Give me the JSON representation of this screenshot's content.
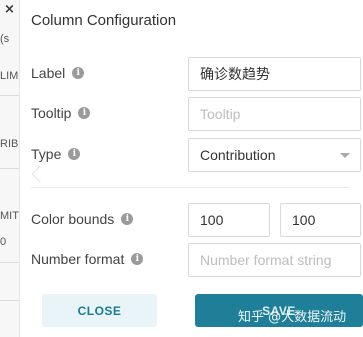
{
  "background": {
    "close_glyph": "×",
    "fragments": [
      "(s",
      "LIM",
      "RIB",
      "MIT",
      "0"
    ]
  },
  "dialog": {
    "title": "Column Configuration",
    "info_glyph": "i",
    "fields": {
      "label": {
        "label": "Label",
        "value": "确诊数趋势"
      },
      "tooltip": {
        "label": "Tooltip",
        "value": "",
        "placeholder": "Tooltip"
      },
      "type": {
        "label": "Type",
        "value": "Contribution"
      },
      "color_bounds": {
        "label": "Color bounds",
        "min": "100",
        "max": "100"
      },
      "number_format": {
        "label": "Number format",
        "value": "",
        "placeholder": "Number format string"
      }
    },
    "buttons": {
      "close": "CLOSE",
      "save": "SAVE"
    },
    "watermark": "知乎 @大数据流动"
  }
}
